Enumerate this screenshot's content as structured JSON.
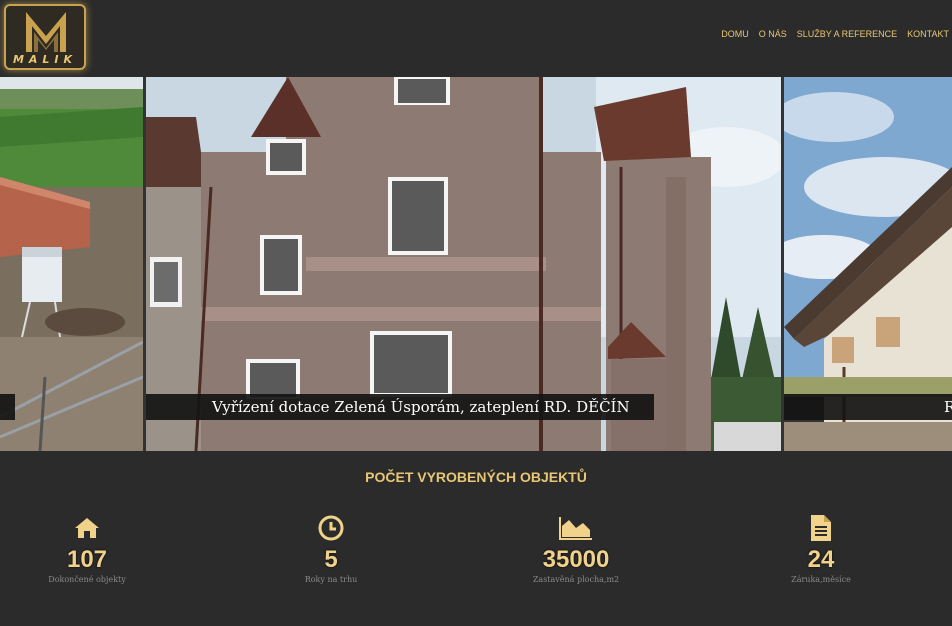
{
  "header": {
    "logo_text": "MALIK",
    "nav": [
      "DOMU",
      "O NÁS",
      "SLUŽBY A REFERENCE",
      "KONTAKT"
    ]
  },
  "slider": {
    "slides": [
      {
        "caption": ""
      },
      {
        "caption": "Vyřízení dotace Zelená Úsporám, zateplení RD. DĚČÍN"
      },
      {
        "caption": "R"
      }
    ]
  },
  "stats": {
    "title": "POČET VYROBENÝCH OBJEKTŮ",
    "items": [
      {
        "icon": "home-icon",
        "value": "107",
        "label": "Dokončené objekty"
      },
      {
        "icon": "clock-icon",
        "value": "5",
        "label": "Roky na trhu"
      },
      {
        "icon": "area-chart-icon",
        "value": "35000",
        "label": "Zastavěná plocha,m2"
      },
      {
        "icon": "document-icon",
        "value": "24",
        "label": "Záruka,měsíce"
      }
    ]
  },
  "colors": {
    "accent": "#e8c774",
    "background": "#2b2b2b"
  }
}
